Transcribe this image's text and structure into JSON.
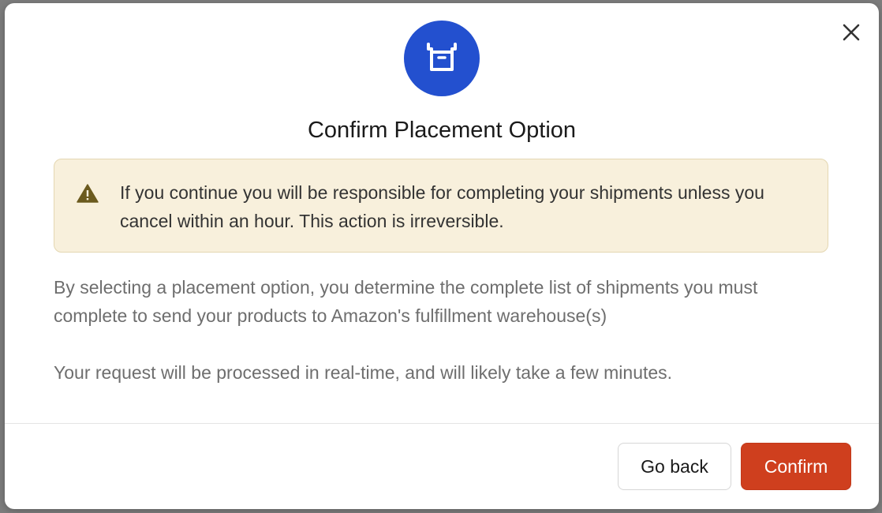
{
  "dialog": {
    "title": "Confirm Placement Option",
    "header_icon": "box-icon",
    "close_icon": "close-icon",
    "accent_color": "#2350cf"
  },
  "alert": {
    "icon": "warning-icon",
    "text": "If you continue you will be responsible for completing your shipments unless you cancel within an hour. This action is irreversible.",
    "background": "#f8f0dc"
  },
  "body": {
    "paragraph_1": "By selecting a placement option, you determine the complete list of shipments you must complete to send your products to Amazon's fulfillment warehouse(s)",
    "paragraph_2": "Your request will be processed in real-time, and will likely take a few minutes."
  },
  "footer": {
    "go_back_label": "Go back",
    "confirm_label": "Confirm",
    "confirm_color": "#cf3f1e"
  }
}
